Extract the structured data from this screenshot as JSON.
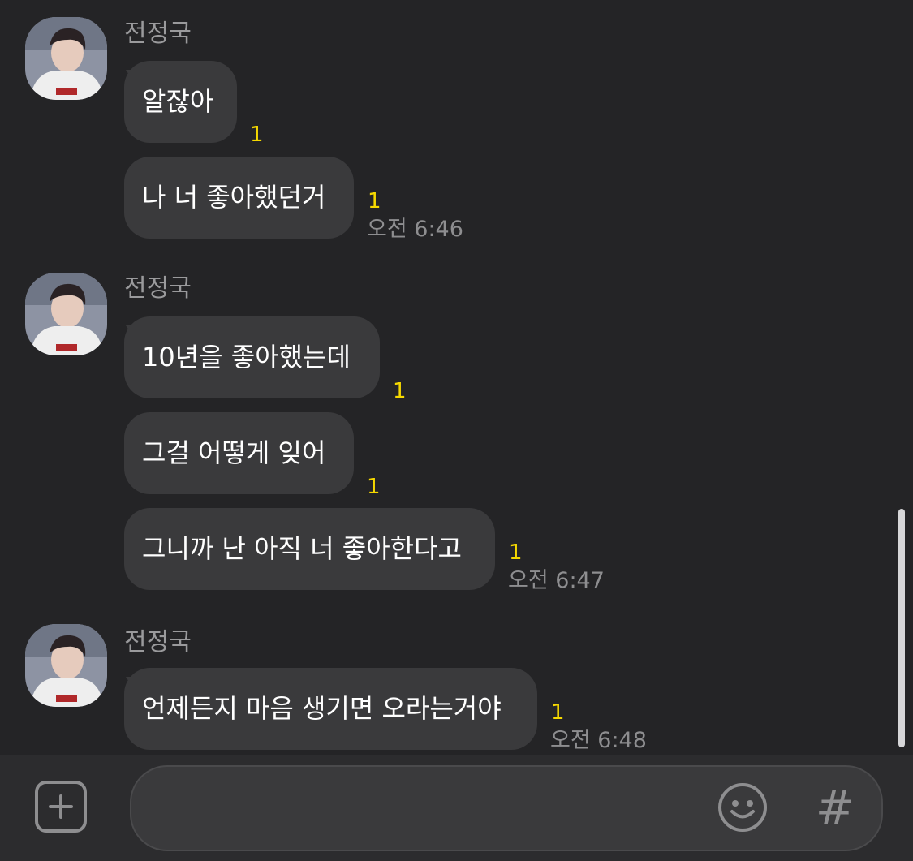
{
  "chat": {
    "sender_name": "전정국",
    "unread_mark": "1",
    "groups": [
      {
        "sender": "전정국",
        "messages": [
          {
            "text": "알잖아",
            "unread": "1"
          },
          {
            "text": "나 너 좋아했던거",
            "unread": "1",
            "time": "오전 6:46"
          }
        ]
      },
      {
        "sender": "전정국",
        "messages": [
          {
            "text": "10년을 좋아했는데",
            "unread": "1"
          },
          {
            "text": "그걸 어떻게 잊어",
            "unread": "1"
          },
          {
            "text": "그니까 난 아직 너 좋아한다고",
            "unread": "1",
            "time": "오전 6:47"
          }
        ]
      },
      {
        "sender": "전정국",
        "messages": [
          {
            "text": "언제든지 마음 생기면 오라는거야",
            "unread": "1",
            "time": "오전 6:48"
          }
        ]
      }
    ]
  },
  "input_bar": {
    "message_value": "",
    "plus_icon": "plus-square-icon",
    "emoji_icon": "smiley-icon",
    "hash_label": "#"
  },
  "colors": {
    "background": "#242426",
    "bubble": "#3a3a3c",
    "unread": "#f5d800",
    "meta_text": "#8e8e90"
  }
}
